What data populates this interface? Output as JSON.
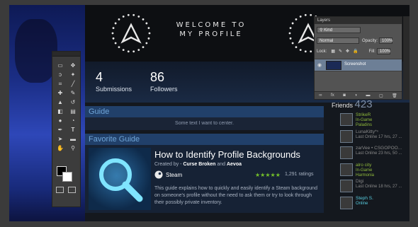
{
  "header": {
    "welcome_line1": "WELCOME TO",
    "welcome_line2": "MY PROFILE"
  },
  "stats": [
    {
      "value": "4",
      "label": "Submissions"
    },
    {
      "value": "86",
      "label": "Followers"
    }
  ],
  "guide_panel": {
    "title": "Guide",
    "text": "Some text I want to center."
  },
  "favorite_guide": {
    "panel_title": "Favorite Guide",
    "title": "How to Identify Profile Backgrounds",
    "created_by_label": "Created by -",
    "author1": "Curse Broken",
    "and_label": "and",
    "author2": "Aevoa",
    "platform": "Steam",
    "stars": "★★★★★",
    "ratings": "1,291 ratings",
    "description": "This guide explains how to quickly and easily identify a Steam background on someone's profile without the need to ask them or try to look through their possibly private inventory."
  },
  "friends": {
    "label": "Friends",
    "count": "423",
    "list": [
      {
        "name": "StrikeR",
        "status": "In-Game",
        "status2": "Paladins",
        "color": "#90ba3c"
      },
      {
        "name": "LunaKitty*ⁿ",
        "status": "Last Online 17 hrs, 27 ...",
        "status2": "",
        "color": "#898989"
      },
      {
        "name": "zarVee • CSGOPOO...",
        "status": "Last Online 23 hrs, 50 ...",
        "status2": "",
        "color": "#898989"
      },
      {
        "name": "alro city",
        "status": "In-Game",
        "status2": "Harmonia",
        "color": "#90ba3c"
      },
      {
        "name": "Digi",
        "status": "Last Online 18 hrs, 27 ...",
        "status2": "",
        "color": "#898989"
      },
      {
        "name": "Steph S.",
        "status": "Online",
        "status2": "",
        "color": "#57cbde"
      }
    ]
  },
  "layers_panel": {
    "tab": "Layers",
    "kind_label": "Kind",
    "blend_mode": "Normal",
    "opacity_label": "Opacity:",
    "opacity_value": "100%",
    "lock_label": "Lock:",
    "fill_label": "Fill:",
    "fill_value": "100%",
    "layer_name": "Screenshot"
  },
  "colors": {
    "accent_blue": "#6fa5d8",
    "ingame_green": "#90ba3c",
    "online_blue": "#57cbde",
    "star_green": "#74c12a"
  }
}
